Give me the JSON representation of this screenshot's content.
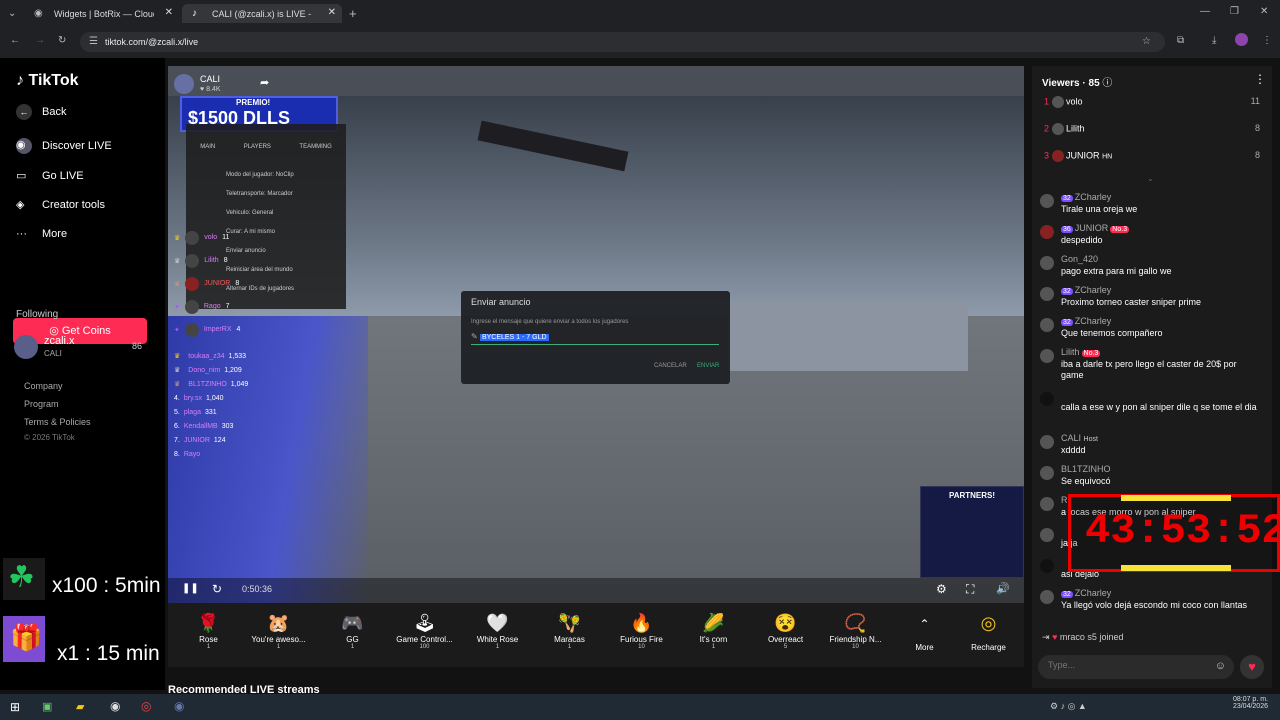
{
  "browser": {
    "tabs": [
      {
        "title": "Widgets | BotRix — Cloud Stre"
      },
      {
        "title": "CALI (@zcali.x) is LIVE - Tik"
      }
    ],
    "url": "tiktok.com/@zcali.x/live"
  },
  "sidebar": {
    "logo": "TikTok",
    "back": "Back",
    "items": [
      {
        "label": "Discover LIVE",
        "icon": "live-icon"
      },
      {
        "label": "Go LIVE",
        "icon": "camera-icon"
      },
      {
        "label": "Creator tools",
        "icon": "lightbulb-icon"
      },
      {
        "label": "More",
        "icon": "more-icon"
      }
    ],
    "get_coins": "Get Coins",
    "following_label": "Following",
    "following": [
      {
        "name": "zcali.x",
        "sub": "CALI",
        "count": "86"
      }
    ],
    "footer": [
      "Company",
      "Program",
      "Terms & Policies",
      "© 2026 TikTok"
    ]
  },
  "stream": {
    "host": "CALI",
    "likes": "8.4K",
    "premio_label": "PREMIO!",
    "prize": "$1500 DLLS",
    "panel_tabs": [
      "MAIN",
      "PLAYERS",
      "TEAMMING"
    ],
    "panel_items": [
      "Modo del jugador: NoClip",
      "Teletransporte: Marcador",
      "Vehiculo: General",
      "Curar: A mi mismo",
      "Enviar anuncio",
      "Reiniciar área del mundo",
      "Alternar IDs de jugadores"
    ],
    "leaderboard_top": [
      {
        "name": "volo",
        "value": "11"
      },
      {
        "name": "Lilith",
        "value": "8"
      },
      {
        "name": "JUNIOR",
        "value": "8"
      },
      {
        "name": "Rago",
        "value": "7"
      },
      {
        "name": "ImperRX",
        "value": "4"
      }
    ],
    "leaderboard": [
      {
        "rank": "",
        "name": "toukaa_z34",
        "value": "1,533"
      },
      {
        "rank": "",
        "name": "Dono_nim",
        "value": "1,209"
      },
      {
        "rank": "",
        "name": "BL1TZINHO",
        "value": "1,049"
      },
      {
        "rank": "4.",
        "name": "bry.sx",
        "value": "1,040"
      },
      {
        "rank": "5.",
        "name": "plaga",
        "value": "331"
      },
      {
        "rank": "6.",
        "name": "KendallMB",
        "value": "303"
      },
      {
        "rank": "7.",
        "name": "JUNIOR",
        "value": "124"
      },
      {
        "rank": "8.",
        "name": "Rayo",
        "value": ""
      }
    ],
    "dialog": {
      "title": "Enviar anuncio",
      "prompt": "Ingrese el mensaje que quiere enviar a todos los jugadores",
      "value": "BYCELES 1 - 7 GLD",
      "cancel": "CANCELAR",
      "send": "ENVIAR"
    },
    "partners": "PARTNERS!",
    "elapsed": "0:50:36"
  },
  "overlay": {
    "line1": "x100 : 5min",
    "line2": "x1 : 15 min",
    "timer": "43:53:52"
  },
  "gifts": [
    {
      "name": "Rose",
      "cost": "1",
      "icon": "🌹"
    },
    {
      "name": "You're aweso...",
      "cost": "1",
      "icon": "🐹"
    },
    {
      "name": "GG",
      "cost": "1",
      "icon": "🎮"
    },
    {
      "name": "Game Control...",
      "cost": "100",
      "icon": "🕹"
    },
    {
      "name": "White Rose",
      "cost": "1",
      "icon": "🤍"
    },
    {
      "name": "Maracas",
      "cost": "1",
      "icon": "🪇"
    },
    {
      "name": "Furious Fire",
      "cost": "10",
      "icon": "🔥"
    },
    {
      "name": "It's corn",
      "cost": "1",
      "icon": "🌽"
    },
    {
      "name": "Overreact",
      "cost": "5",
      "icon": "😵"
    },
    {
      "name": "Friendship N...",
      "cost": "10",
      "icon": "📿"
    }
  ],
  "gift_more": "More",
  "recharge": "Recharge",
  "recommended": "Recommended LIVE streams",
  "chat": {
    "viewers_label": "Viewers · 85",
    "top_viewers": [
      {
        "rank": "1",
        "name": "volo",
        "score": "11"
      },
      {
        "rank": "2",
        "name": "Lilith",
        "score": "8"
      },
      {
        "rank": "3",
        "name": "JUNIOR",
        "score": "8",
        "tag": "HN"
      }
    ],
    "messages": [
      {
        "badge": "32",
        "user": "ZCharley",
        "text": "Tirale una oreja we"
      },
      {
        "badge": "36",
        "user": "JUNIOR",
        "rank": "No.3",
        "text": "despedido"
      },
      {
        "badge": "",
        "user": "Gon_420",
        "text": "pago extra para mi gallo we"
      },
      {
        "badge": "32",
        "user": "ZCharley",
        "text": "Proximo torneo caster sniper prime"
      },
      {
        "badge": "32",
        "user": "ZCharley",
        "text": "Que tenemos compañero"
      },
      {
        "badge": "",
        "user": "Lilith",
        "rank": "No.3",
        "text": "iba a darle tx pero llego el caster de 20$ por game"
      },
      {
        "badge": "",
        "user": "",
        "text": "calla a ese w y pon al sniper dile q se tome el dia"
      },
      {
        "badge": "",
        "user": "CALI",
        "host": "Host",
        "text": "xdddd"
      },
      {
        "badge": "",
        "user": "BL1TZINHO",
        "text": "Se equivocó"
      },
      {
        "badge": "",
        "user": "R",
        "text": "a locas ese morro w pon al sniper"
      },
      {
        "badge": "",
        "user": "",
        "text": "ja ja"
      },
      {
        "badge": "",
        "user": "",
        "text": "asi dejalo"
      },
      {
        "badge": "32",
        "user": "ZCharley",
        "text": "Ya llegó volo dejá escondo mi coco con llantas"
      }
    ],
    "joined": "mraco s5",
    "joined_suffix": "joined",
    "input_placeholder": "Type..."
  },
  "taskbar": {
    "time": "08:07 p. m.",
    "date": "23/04/2026"
  }
}
